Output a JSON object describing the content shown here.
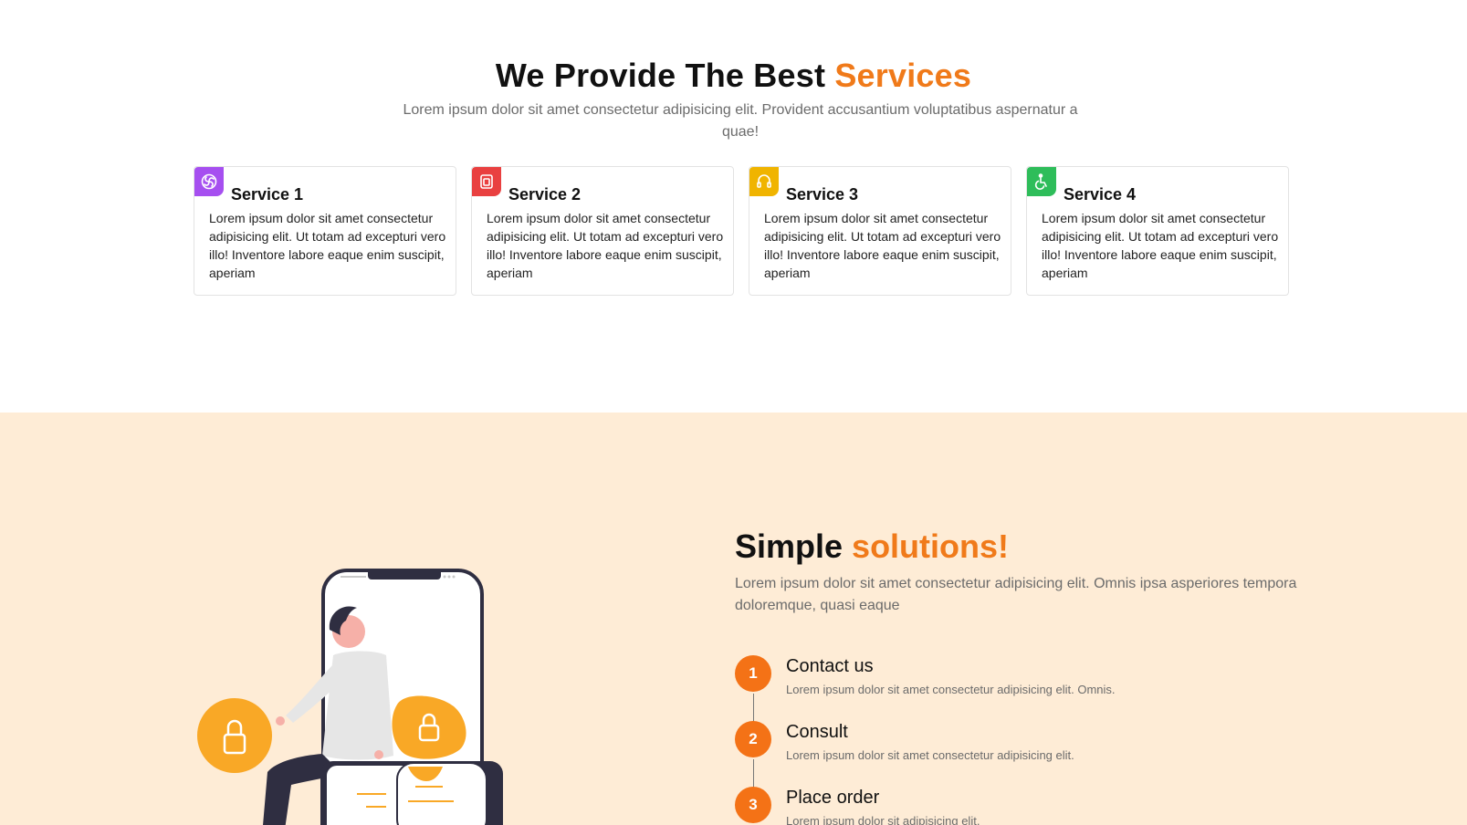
{
  "services": {
    "title_main": "We Provide The Best ",
    "title_accent": "Services",
    "subtitle": "Lorem ipsum dolor sit amet consectetur adipisicing elit. Provident accusantium voluptatibus aspernatur a quae!",
    "cards": [
      {
        "title": "Service 1",
        "text": "Lorem ipsum dolor sit amet consectetur adipisicing elit. Ut totam ad excepturi vero illo! Inventore labore eaque enim suscipit, aperiam",
        "icon": "swirl-icon",
        "color": "#a64ff0"
      },
      {
        "title": "Service 2",
        "text": "Lorem ipsum dolor sit amet consectetur adipisicing elit. Ut totam ad excepturi vero illo! Inventore labore eaque enim suscipit, aperiam",
        "icon": "copy-icon",
        "color": "#e94040"
      },
      {
        "title": "Service 3",
        "text": "Lorem ipsum dolor sit amet consectetur adipisicing elit. Ut totam ad excepturi vero illo! Inventore labore eaque enim suscipit, aperiam",
        "icon": "headset-icon",
        "color": "#f0b400"
      },
      {
        "title": "Service 4",
        "text": "Lorem ipsum dolor sit amet consectetur adipisicing elit. Ut totam ad excepturi vero illo! Inventore labore eaque enim suscipit, aperiam",
        "icon": "accessibility-icon",
        "color": "#2ebd5a"
      }
    ]
  },
  "solutions": {
    "title_main": "Simple ",
    "title_accent": "solutions!",
    "subtitle": "Lorem ipsum dolor sit amet consectetur adipisicing elit. Omnis ipsa asperiores tempora doloremque, quasi eaque",
    "steps": [
      {
        "num": "1",
        "title": "Contact us",
        "text": "Lorem ipsum dolor sit amet consectetur adipisicing elit. Omnis."
      },
      {
        "num": "2",
        "title": "Consult",
        "text": "Lorem ipsum dolor sit amet consectetur adipisicing elit."
      },
      {
        "num": "3",
        "title": "Place order",
        "text": "Lorem ipsum dolor sit adipisicing elit."
      }
    ]
  },
  "colors": {
    "accent": "#f07a1a",
    "step_circle": "#f47216",
    "solutions_bg": "#feecd6",
    "illustration_orange": "#f9a826"
  }
}
